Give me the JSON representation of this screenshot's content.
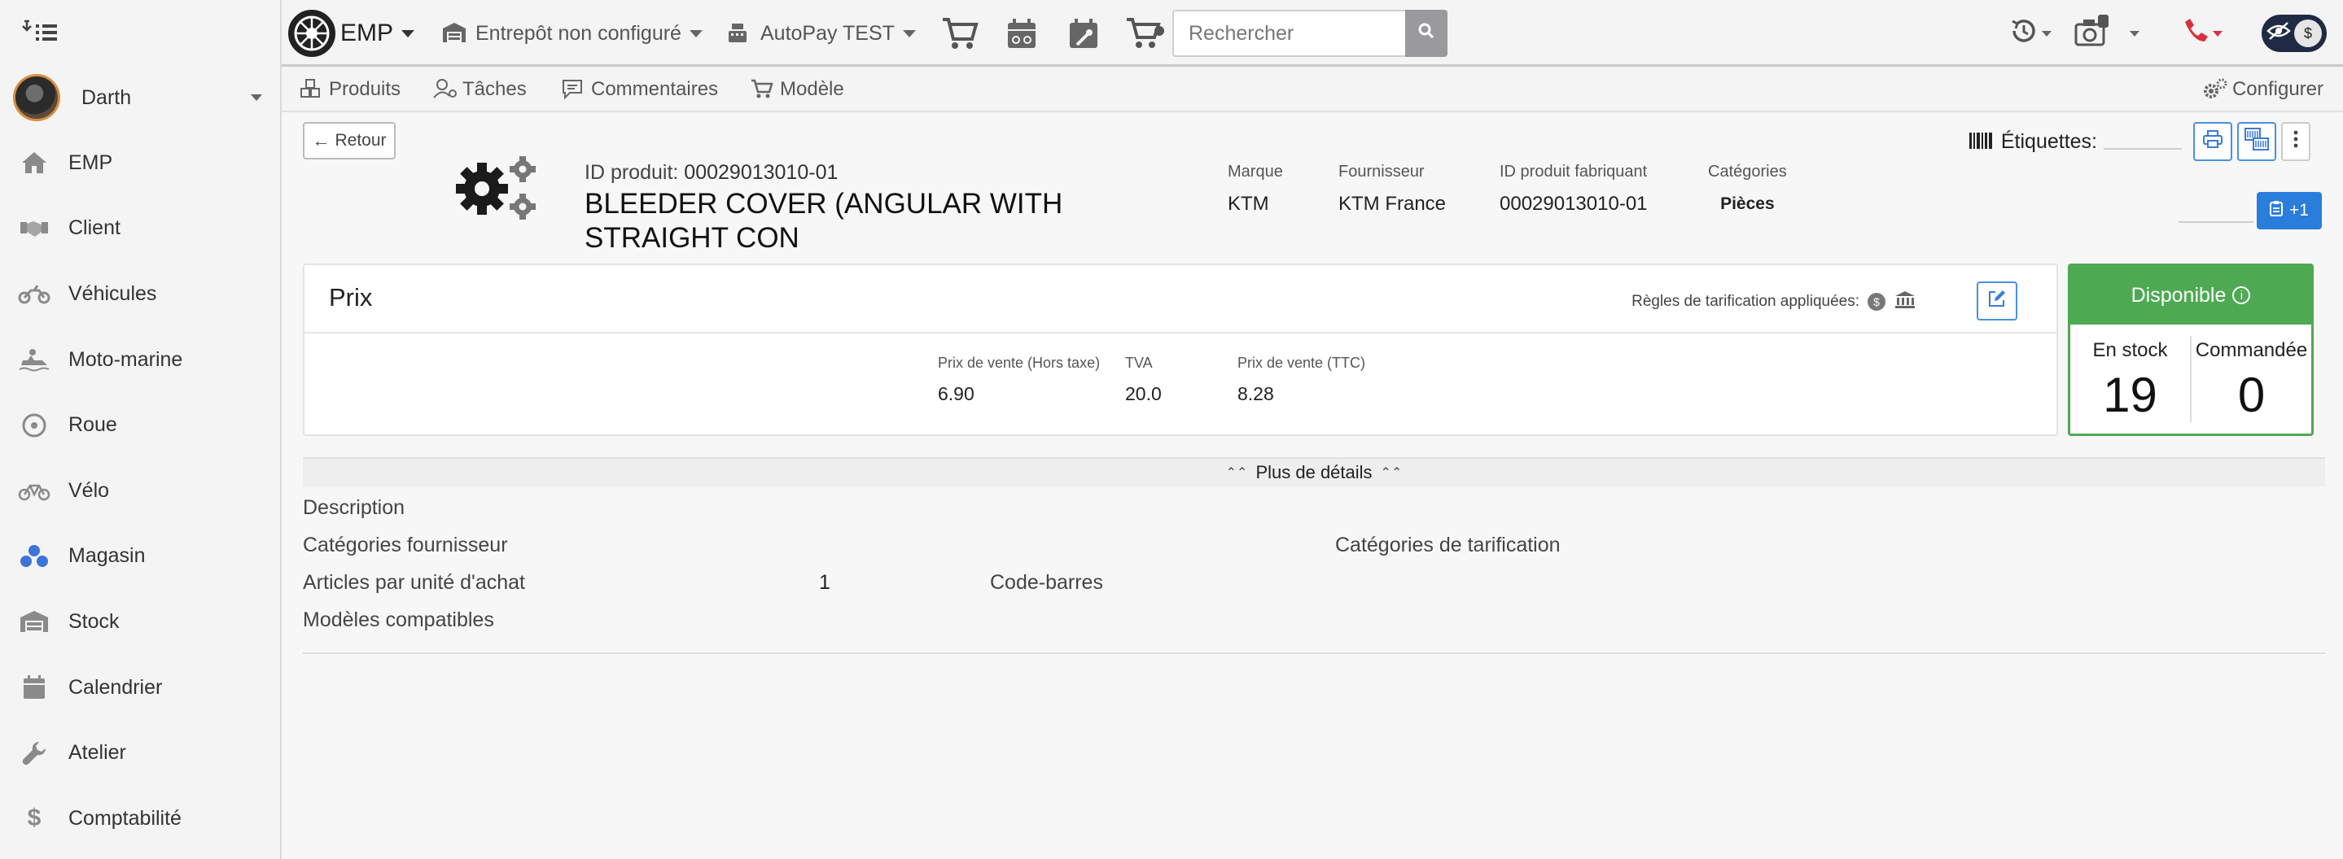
{
  "sidebar": {
    "user": {
      "name": "Darth"
    },
    "items": [
      {
        "label": "EMP",
        "icon": "home-icon"
      },
      {
        "label": "Client",
        "icon": "handshake-icon"
      },
      {
        "label": "Véhicules",
        "icon": "motorcycle-icon"
      },
      {
        "label": "Moto-marine",
        "icon": "jetski-icon"
      },
      {
        "label": "Roue",
        "icon": "wheel-icon"
      },
      {
        "label": "Vélo",
        "icon": "bicycle-icon"
      },
      {
        "label": "Magasin",
        "icon": "boxes-icon",
        "active": true
      },
      {
        "label": "Stock",
        "icon": "warehouse-icon"
      },
      {
        "label": "Calendrier",
        "icon": "calendar-icon"
      },
      {
        "label": "Atelier",
        "icon": "wrench-icon"
      },
      {
        "label": "Comptabilité",
        "icon": "dollar-icon"
      }
    ]
  },
  "topbar": {
    "brand": "EMP",
    "warehouse": "Entrepôt non configuré",
    "payment": "AutoPay TEST",
    "search_placeholder": "Rechercher",
    "toggle_symbol": "$"
  },
  "subtabs": {
    "produits": "Produits",
    "taches": "Tâches",
    "commentaires": "Commentaires",
    "modele": "Modèle",
    "configurer": "Configurer"
  },
  "product": {
    "back_label": "Retour",
    "id_label": "ID produit:",
    "id_value": "00029013010-01",
    "title": "BLEEDER COVER (ANGULAR WITH STRAIGHT CON",
    "marque_label": "Marque",
    "marque": "KTM",
    "fournisseur_label": "Fournisseur",
    "fournisseur": "KTM France",
    "fab_label": "ID produit fabriquant",
    "fab_value": "00029013010-01",
    "categories_label": "Catégories",
    "categories": "Pièces"
  },
  "labels": {
    "title": "Étiquettes:",
    "plus_one": "+1"
  },
  "price": {
    "title": "Prix",
    "rules_label": "Règles de tarification appliquées:",
    "rules_coin": "$",
    "ht_label": "Prix de vente (Hors taxe)",
    "ht_value": "6.90",
    "tva_label": "TVA",
    "tva_value": "20.0",
    "ttc_label": "Prix de vente (TTC)",
    "ttc_value": "8.28"
  },
  "stock": {
    "status": "Disponible",
    "in_stock_label": "En stock",
    "in_stock": "19",
    "ordered_label": "Commandée",
    "ordered": "0"
  },
  "details": {
    "toggle": "Plus de détails",
    "description": "Description",
    "supplier_categories": "Catégories fournisseur",
    "pricing_categories": "Catégories de tarification",
    "units_label": "Articles par unité d'achat",
    "units_value": "1",
    "barcode": "Code-barres",
    "compatible_models": "Modèles compatibles"
  },
  "colors": {
    "accent": "#2b7ddb",
    "available": "#4ea953",
    "phone": "#d9303a"
  }
}
